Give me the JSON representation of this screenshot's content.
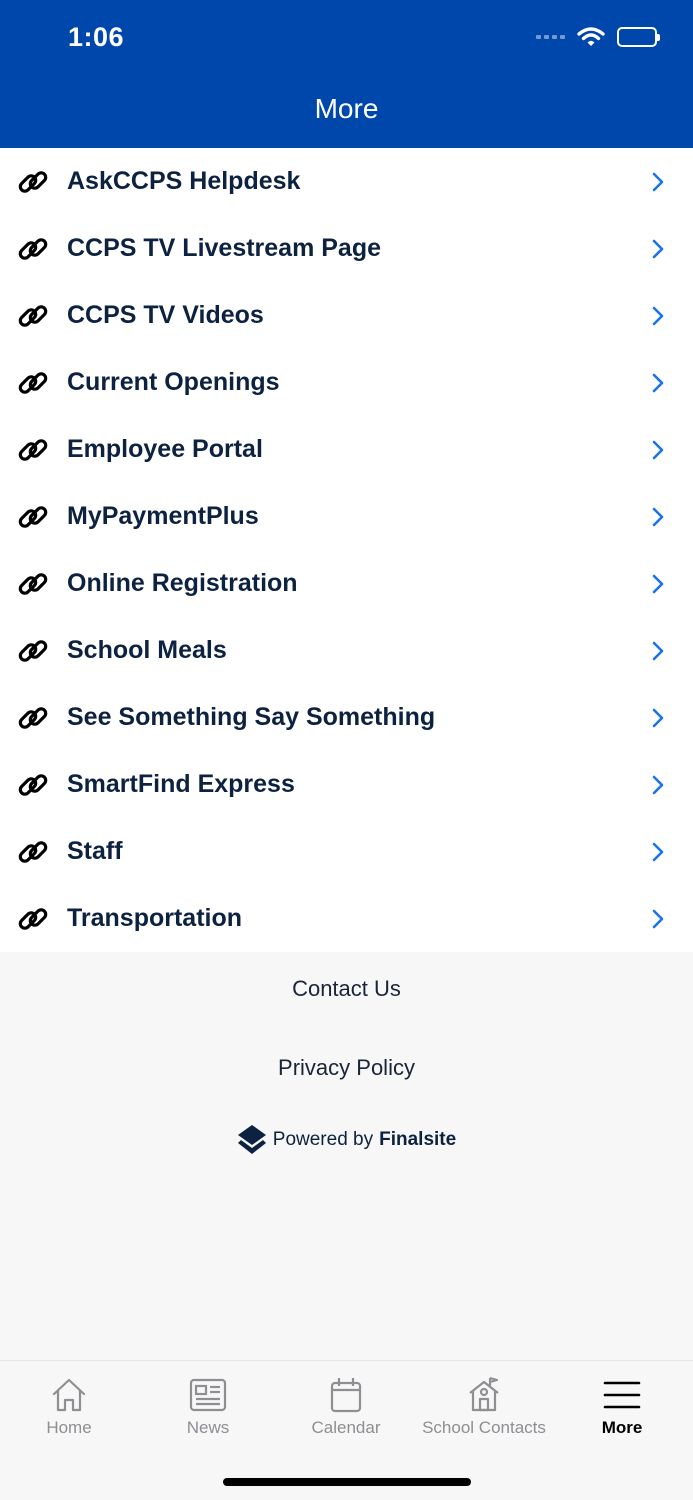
{
  "status_bar": {
    "time": "1:06",
    "icons": [
      "signal-icon",
      "wifi-icon",
      "battery-icon"
    ]
  },
  "header": {
    "title": "More",
    "background": "#0047ab"
  },
  "links": [
    {
      "label": "AskCCPS Helpdesk",
      "icon": "link-icon"
    },
    {
      "label": "CCPS TV Livestream Page",
      "icon": "link-icon"
    },
    {
      "label": "CCPS TV Videos",
      "icon": "link-icon"
    },
    {
      "label": "Current Openings",
      "icon": "link-icon"
    },
    {
      "label": "Employee Portal",
      "icon": "link-icon"
    },
    {
      "label": "MyPaymentPlus",
      "icon": "link-icon"
    },
    {
      "label": "Online Registration",
      "icon": "link-icon"
    },
    {
      "label": "School Meals",
      "icon": "link-icon"
    },
    {
      "label": "See Something Say Something",
      "icon": "link-icon"
    },
    {
      "label": "SmartFind Express",
      "icon": "link-icon"
    },
    {
      "label": "Staff",
      "icon": "link-icon"
    },
    {
      "label": "Transportation",
      "icon": "link-icon"
    }
  ],
  "footer": {
    "contact_label": "Contact Us",
    "privacy_label": "Privacy Policy",
    "powered_prefix": "Powered by",
    "powered_brand": "Finalsite"
  },
  "tabbar": {
    "tabs": [
      {
        "label": "Home",
        "icon": "home-icon",
        "active": false
      },
      {
        "label": "News",
        "icon": "news-icon",
        "active": false
      },
      {
        "label": "Calendar",
        "icon": "calendar-icon",
        "active": false
      },
      {
        "label": "School Contacts",
        "icon": "school-icon",
        "active": false
      },
      {
        "label": "More",
        "icon": "menu-icon",
        "active": true
      }
    ]
  },
  "colors": {
    "accent": "#0047ab",
    "chevron": "#1a73e8",
    "text": "#0d2240"
  }
}
